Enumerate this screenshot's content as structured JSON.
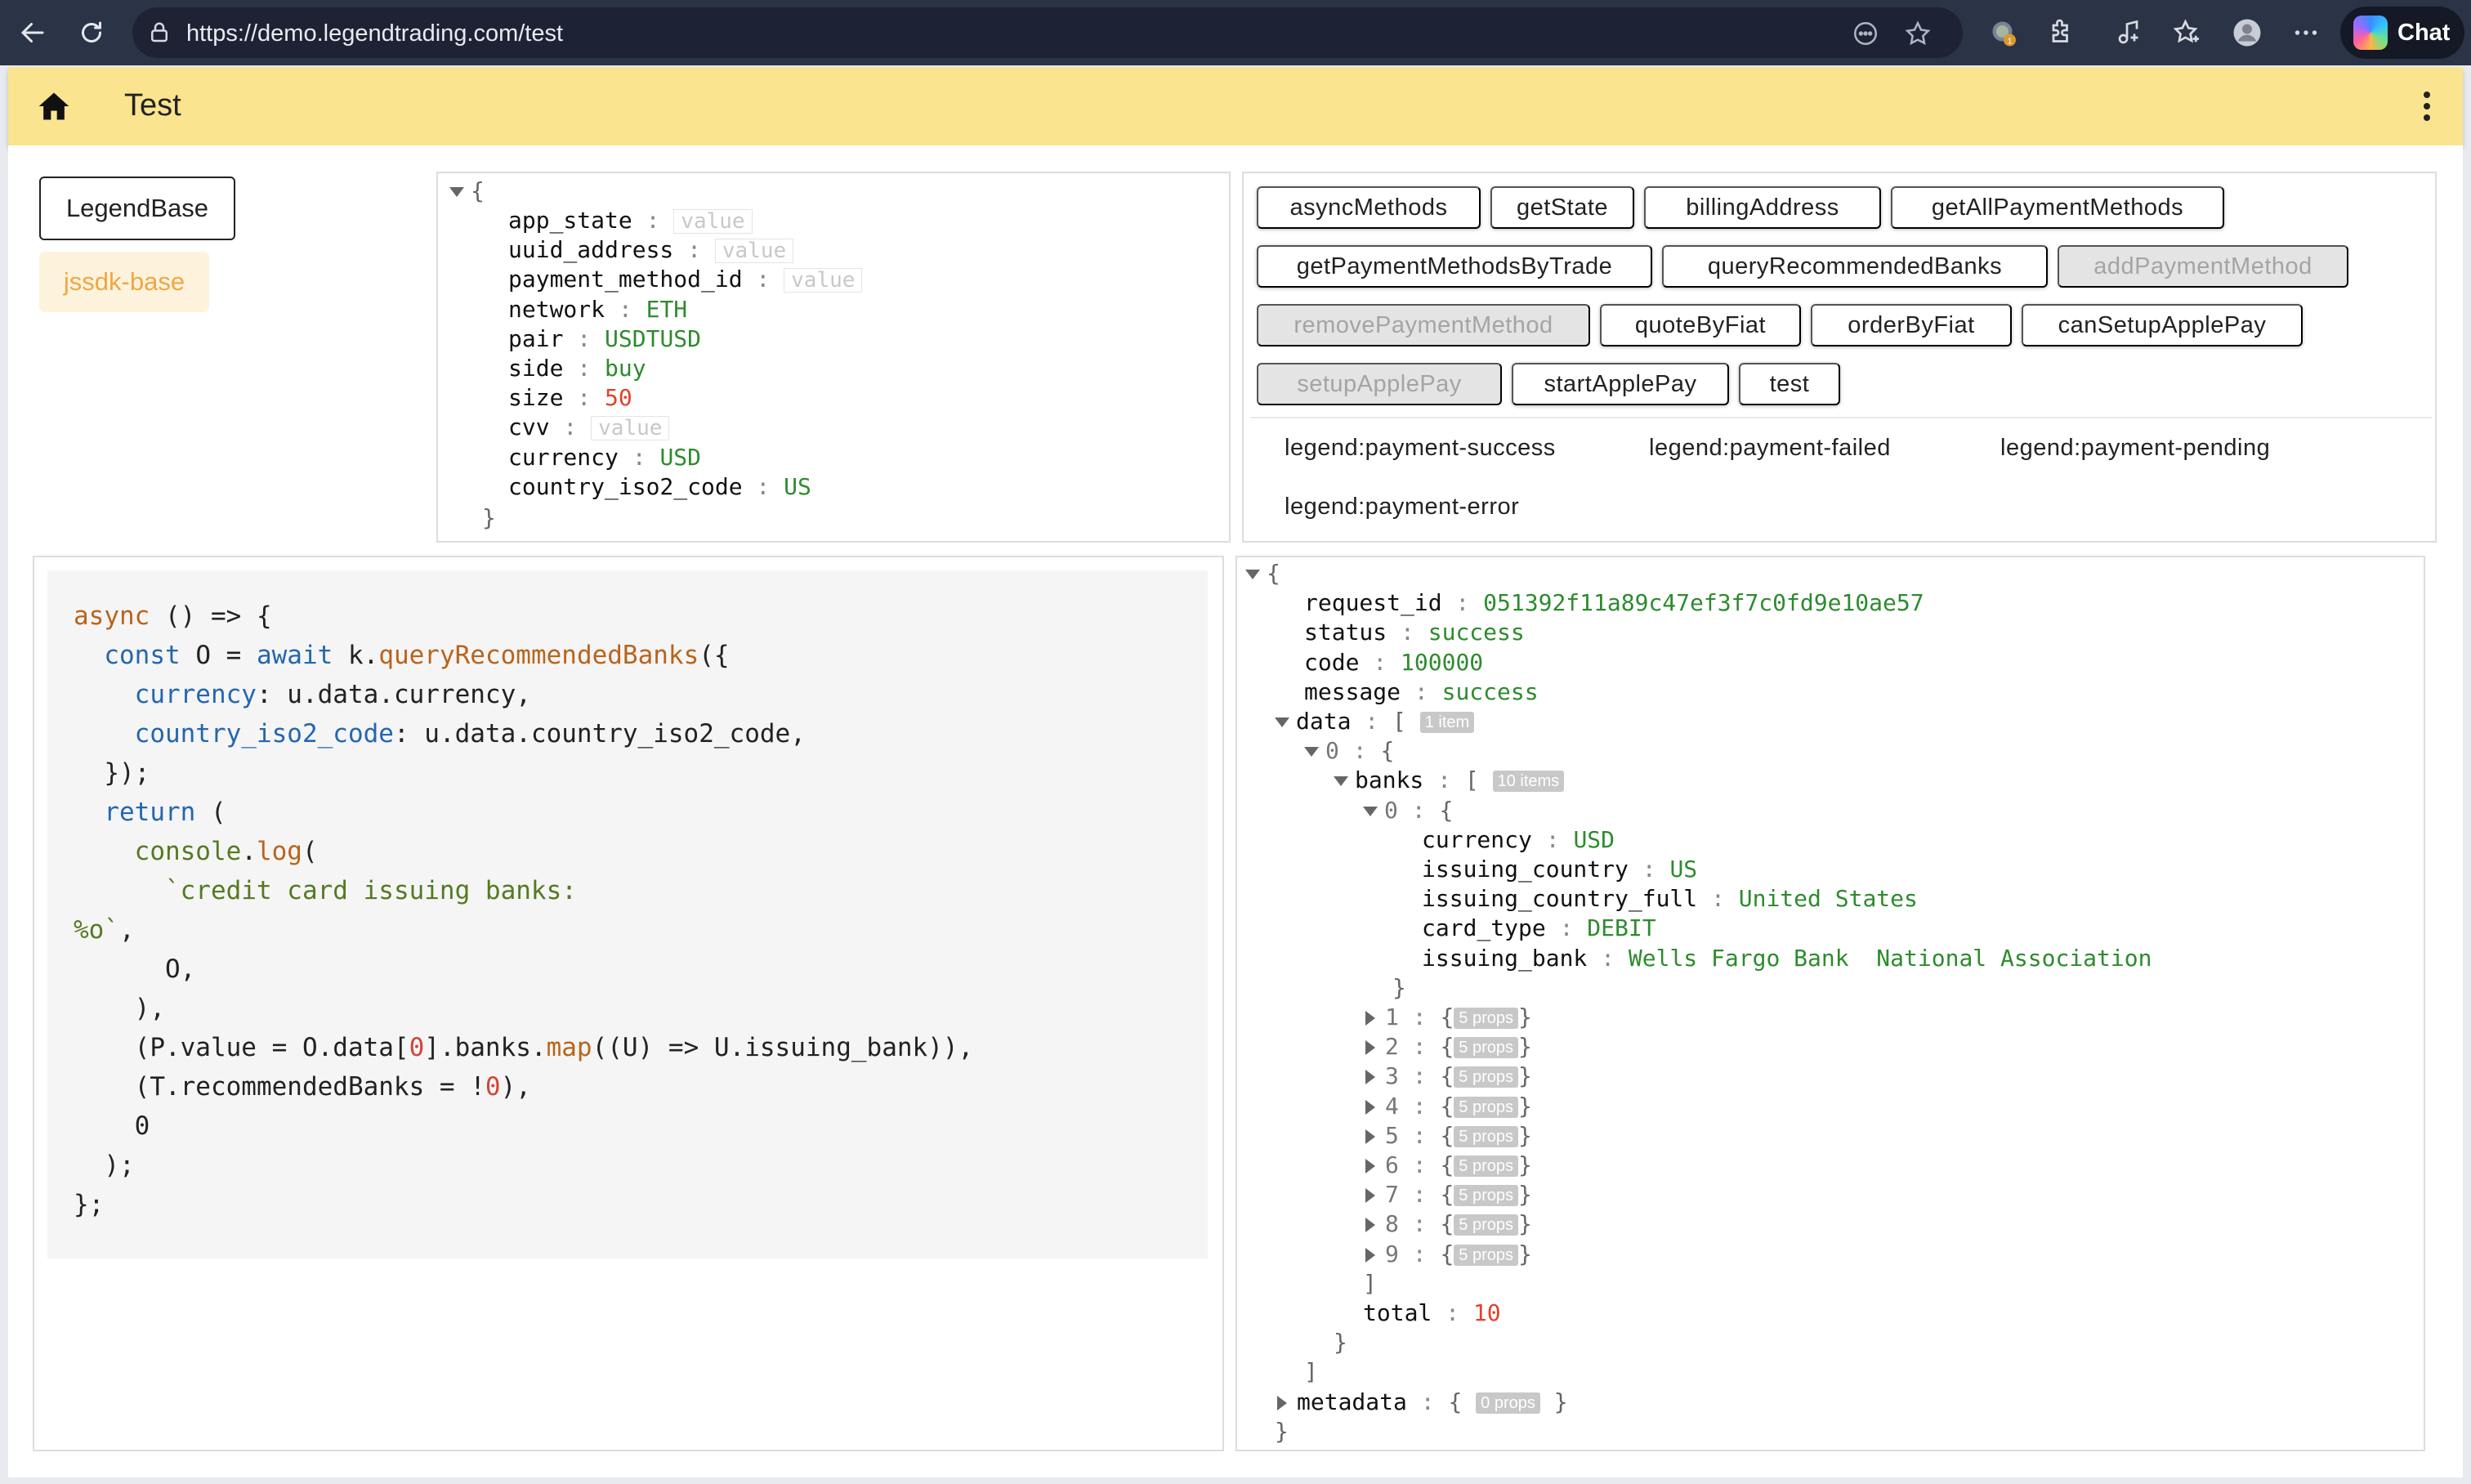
{
  "browser": {
    "url": "https://demo.legendtrading.com/test",
    "chat_label": "Chat",
    "extension_badge": "1"
  },
  "header": {
    "title": "Test"
  },
  "sidebar": {
    "primary_button": "LegendBase",
    "tag": "jssdk-base"
  },
  "params": {
    "fields": [
      {
        "key": "app_state",
        "value": "",
        "placeholder": "value"
      },
      {
        "key": "uuid_address",
        "value": "",
        "placeholder": "value"
      },
      {
        "key": "payment_method_id",
        "value": "",
        "placeholder": "value"
      },
      {
        "key": "network",
        "value": "ETH"
      },
      {
        "key": "pair",
        "value": "USDTUSD"
      },
      {
        "key": "side",
        "value": "buy"
      },
      {
        "key": "size",
        "value": "50"
      },
      {
        "key": "cvv",
        "value": "",
        "placeholder": "value"
      },
      {
        "key": "currency",
        "value": "USD"
      },
      {
        "key": "country_iso2_code",
        "value": "US"
      }
    ]
  },
  "methods": {
    "buttons": [
      {
        "label": "asyncMethods",
        "disabled": false
      },
      {
        "label": "getState",
        "disabled": false
      },
      {
        "label": "billingAddress",
        "disabled": false
      },
      {
        "label": "getAllPaymentMethods",
        "disabled": false
      },
      {
        "label": "getPaymentMethodsByTrade",
        "disabled": false
      },
      {
        "label": "queryRecommendedBanks",
        "disabled": false
      },
      {
        "label": "addPaymentMethod",
        "disabled": true
      },
      {
        "label": "removePaymentMethod",
        "disabled": true
      },
      {
        "label": "quoteByFiat",
        "disabled": false
      },
      {
        "label": "orderByFiat",
        "disabled": false
      },
      {
        "label": "canSetupApplePay",
        "disabled": false
      },
      {
        "label": "setupApplePay",
        "disabled": true
      },
      {
        "label": "startApplePay",
        "disabled": false
      },
      {
        "label": "test",
        "disabled": false
      }
    ],
    "events": [
      "legend:payment-success",
      "legend:payment-failed",
      "legend:payment-pending",
      "legend:payment-error"
    ]
  },
  "code": {
    "lines": [
      "async () => {",
      "  const O = await k.queryRecommendedBanks({",
      "    currency: u.data.currency,",
      "    country_iso2_code: u.data.country_iso2_code,",
      "  });",
      "  return (",
      "    console.log(",
      "      `credit card issuing banks:",
      "%o`,",
      "      O,",
      "    ),",
      "    (P.value = O.data[0].banks.map((U) => U.issuing_bank)),",
      "    (T.recommendedBanks = !0),",
      "    0",
      "  );",
      "};"
    ]
  },
  "result": {
    "request_id": "051392f11a89c47ef3f7c0fd9e10ae57",
    "status": "success",
    "code": "100000",
    "message": "success",
    "data_key": "data",
    "data_count": "1 item",
    "item_index": "0",
    "banks_key": "banks",
    "banks_count": "10 items",
    "first_bank": {
      "currency": "USD",
      "issuing_country": "US",
      "issuing_country_full": "United States",
      "card_type": "DEBIT",
      "issuing_bank": "Wells Fargo Bank  National Association"
    },
    "collapsed_banks": [
      {
        "index": "1",
        "badge": "5 props"
      },
      {
        "index": "2",
        "badge": "5 props"
      },
      {
        "index": "3",
        "badge": "5 props"
      },
      {
        "index": "4",
        "badge": "5 props"
      },
      {
        "index": "5",
        "badge": "5 props"
      },
      {
        "index": "6",
        "badge": "5 props"
      },
      {
        "index": "7",
        "badge": "5 props"
      },
      {
        "index": "8",
        "badge": "5 props"
      },
      {
        "index": "9",
        "badge": "5 props"
      }
    ],
    "total": "10",
    "metadata_key": "metadata",
    "metadata_badge": "0 props"
  }
}
